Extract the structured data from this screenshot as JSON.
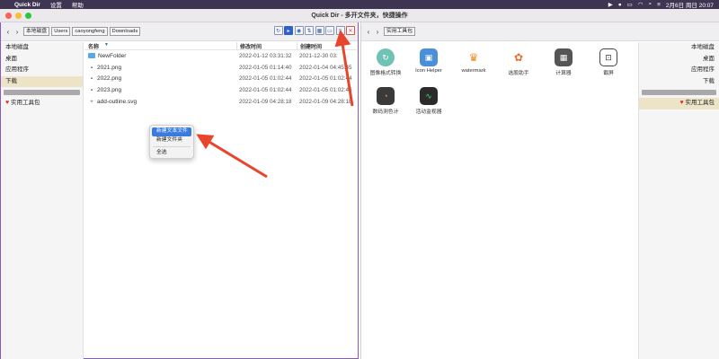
{
  "menubar": {
    "app_name": "Quick Dir",
    "items": [
      "设置",
      "帮助"
    ],
    "datetime": "2月6日 周日 20:07"
  },
  "window": {
    "title": "Quick Dir - 多开文件夹，快捷操作"
  },
  "left_pane": {
    "breadcrumbs": [
      "本地磁盘",
      "Users",
      "caoyongfeng",
      "Downloads"
    ],
    "sidebar": {
      "items": [
        "本地磁盘",
        "桌面",
        "应用程序",
        "下载"
      ],
      "selected_index": 3,
      "favorite": "实用工具包"
    },
    "columns": {
      "name": "名称",
      "modified": "修改时间",
      "created": "创建时间"
    },
    "files": [
      {
        "name": "NewFolder",
        "modified": "2022-01-12 03:31:32",
        "created": "2021-12-30 03:",
        "kind": "folder"
      },
      {
        "name": "2021.png",
        "modified": "2022-01-05 01:14:40",
        "created": "2022-01-04 04:45:45",
        "kind": "image"
      },
      {
        "name": "2022.png",
        "modified": "2022-01-05 01:02:44",
        "created": "2022-01-05 01:02:44",
        "kind": "image"
      },
      {
        "name": "2023.png",
        "modified": "2022-01-05 01:02:44",
        "created": "2022-01-05 01:02:44",
        "kind": "image"
      },
      {
        "name": "add-outline.svg",
        "modified": "2022-01-09 04:28:18",
        "created": "2022-01-09 04:28:18",
        "kind": "svg"
      }
    ]
  },
  "context_menu": {
    "items": [
      "新建文本文件",
      "新建文件夹",
      "全选"
    ],
    "highlighted_index": 0
  },
  "right_pane": {
    "breadcrumbs": [
      "实用工具包"
    ],
    "sidebar": {
      "items": [
        "本地磁盘",
        "桌面",
        "应用程序",
        "下载"
      ],
      "favorite": "实用工具包"
    },
    "tools": [
      {
        "label": "图像格式转换",
        "icon": "convert-icon",
        "color": "#5ab3a8"
      },
      {
        "label": "Icon Helper",
        "icon": "icon-helper-icon",
        "color": "#4a90d9"
      },
      {
        "label": "watermark",
        "icon": "watermark-icon",
        "color": "#f08a24"
      },
      {
        "label": "选股助手",
        "icon": "stock-icon",
        "color": "#ee6b2c"
      },
      {
        "label": "计算器",
        "icon": "calculator-icon",
        "color": "#555555"
      },
      {
        "label": "截屏",
        "icon": "screenshot-icon",
        "color": "#444444"
      },
      {
        "label": "数码测色计",
        "icon": "color-meter-icon",
        "color": "#3a3a3a"
      },
      {
        "label": "活动监视器",
        "icon": "activity-monitor-icon",
        "color": "#2b2b2b"
      }
    ]
  },
  "colors": {
    "accent": "#2f62c9",
    "pane_border": "#8a58c6",
    "arrow": "#e8452c"
  }
}
